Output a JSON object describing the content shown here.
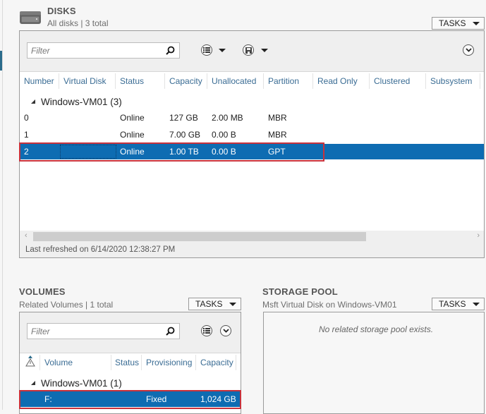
{
  "disks": {
    "title": "DISKS",
    "subtitle": "All disks | 3 total",
    "tasks_label": "TASKS",
    "filter_placeholder": "Filter",
    "icons": {
      "section": "hard-disk-icon",
      "search": "search-icon",
      "list_view": "list-view-icon",
      "save": "save-icon",
      "expand": "chevron-down-icon"
    },
    "columns": [
      "Number",
      "Virtual Disk",
      "Status",
      "Capacity",
      "Unallocated",
      "Partition",
      "Read Only",
      "Clustered",
      "Subsystem"
    ],
    "group": "Windows-VM01 (3)",
    "rows": [
      {
        "number": "0",
        "virtual_disk": "",
        "status": "Online",
        "capacity": "127 GB",
        "unallocated": "2.00 MB",
        "partition": "MBR"
      },
      {
        "number": "1",
        "virtual_disk": "",
        "status": "Online",
        "capacity": "7.00 GB",
        "unallocated": "0.00 B",
        "partition": "MBR"
      },
      {
        "number": "2",
        "virtual_disk": "",
        "status": "Online",
        "capacity": "1.00 TB",
        "unallocated": "0.00 B",
        "partition": "GPT",
        "selected": true
      }
    ],
    "last_refreshed": "Last refreshed on 6/14/2020 12:38:27 PM"
  },
  "volumes": {
    "title": "VOLUMES",
    "subtitle": "Related Volumes | 1 total",
    "tasks_label": "TASKS",
    "filter_placeholder": "Filter",
    "columns": [
      "Volume",
      "Status",
      "Provisioning",
      "Capacity"
    ],
    "warning_col_icon": "warning-icon",
    "group": "Windows-VM01 (1)",
    "rows": [
      {
        "volume": "F:",
        "status": "",
        "provisioning": "Fixed",
        "capacity": "1,024 GB",
        "selected": true
      }
    ]
  },
  "storage_pool": {
    "title": "STORAGE POOL",
    "subtitle": "Msft Virtual Disk on Windows-VM01",
    "tasks_label": "TASKS",
    "empty_message": "No related storage pool exists."
  },
  "colors": {
    "selection": "#0e6cb2",
    "highlight_outline": "#c8323c",
    "column_header": "#3a6c94"
  }
}
